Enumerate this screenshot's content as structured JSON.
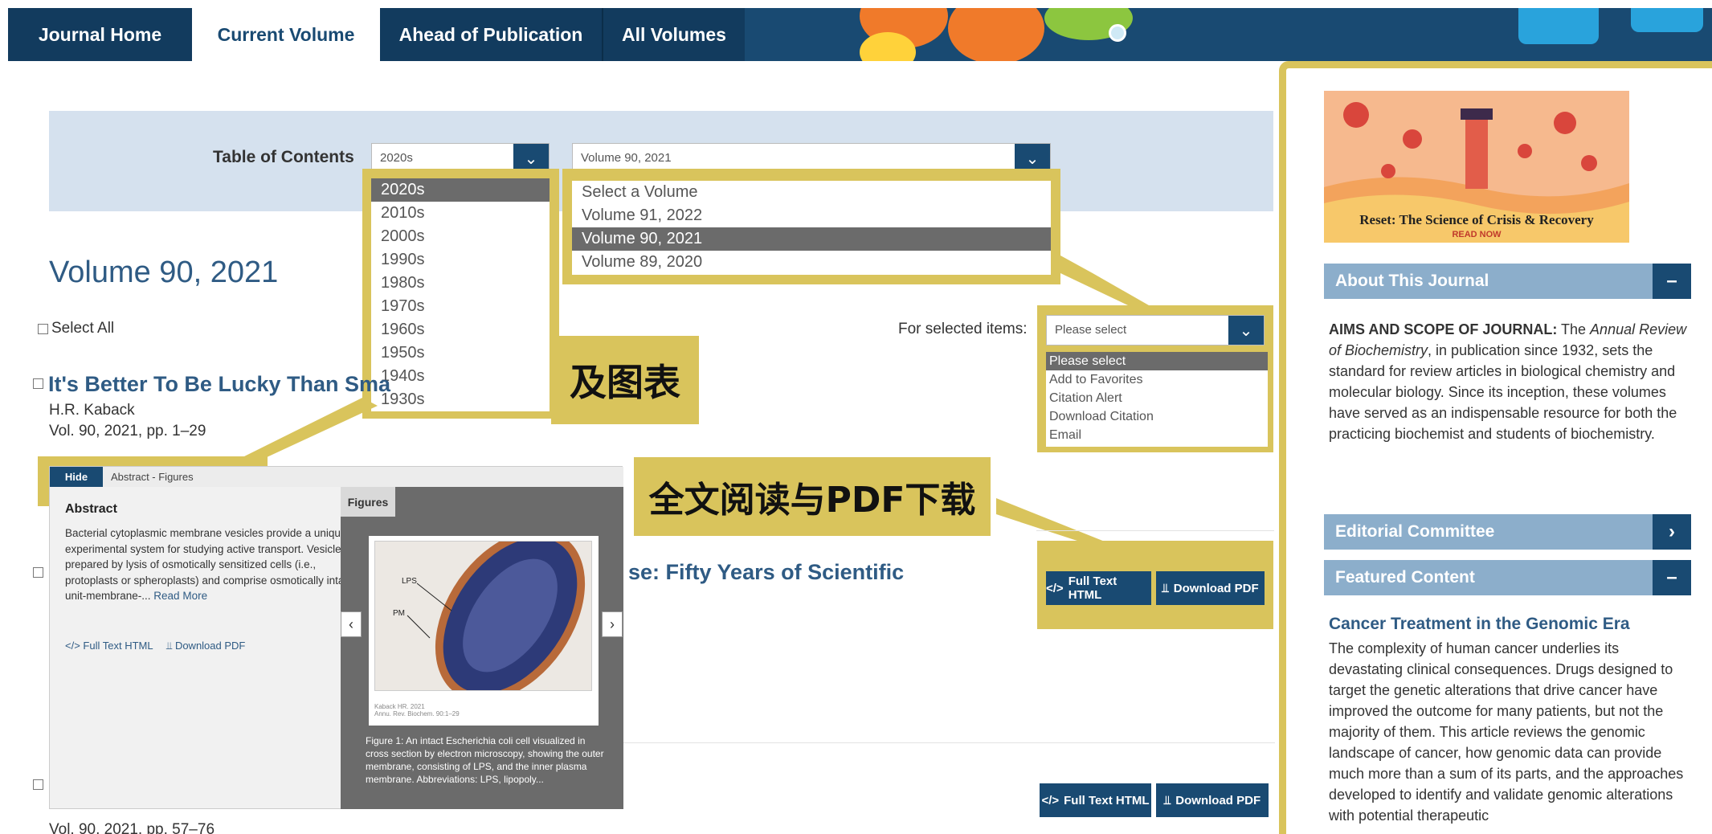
{
  "nav": {
    "tabs": [
      "Journal Home",
      "Current Volume",
      "Ahead of Publication",
      "All Volumes"
    ],
    "active": "Current Volume"
  },
  "toc": {
    "label": "Table of Contents",
    "decade_value": "2020s",
    "volume_value": "Volume 90, 2021",
    "decades": [
      "2020s",
      "2010s",
      "2000s",
      "1990s",
      "1980s",
      "1970s",
      "1960s",
      "1950s",
      "1940s",
      "1930s"
    ],
    "decade_selected": "2020s",
    "volumes": [
      "Select a Volume",
      "Volume 91, 2022",
      "Volume 90, 2021",
      "Volume 89, 2020"
    ],
    "volume_selected": "Volume 90, 2021"
  },
  "main": {
    "volume_heading": "Volume 90, 2021",
    "select_all": "Select All",
    "for_selected_label": "For selected items:",
    "for_selected_value": "Please select",
    "for_selected_options": [
      "Please select",
      "Add to Favorites",
      "Citation Alert",
      "Download Citation",
      "Email"
    ],
    "articles": [
      {
        "title": "It's Better To Be Lucky Than Sma",
        "author": "H.R. Kaback",
        "meta": "Vol. 90, 2021, pp. 1–29"
      },
      {
        "title": "se: Fifty Years of Scientific",
        "full_text": "Full Text HTML",
        "pdf": "Download PDF"
      },
      {
        "meta": "Vol. 90, 2021, pp. 57–76",
        "full_text": "Full Text HTML",
        "pdf": "Download PDF"
      }
    ]
  },
  "popup": {
    "hide": "Hide",
    "crumbs": "Abstract - Figures",
    "abstract_heading": "Abstract",
    "abstract_text": "Bacterial cytoplasmic membrane vesicles provide a unique experimental system for studying active transport. Vesicles are prepared by lysis of osmotically sensitized cells (i.e., protoplasts or spheroplasts) and comprise osmotically intact, unit-membrane-... ",
    "read_more": "Read More",
    "full_text": "Full Text HTML",
    "pdf": "Download PDF",
    "figures_tab": "Figures",
    "fig_labels": [
      "LPS",
      "PM"
    ],
    "fig_credit_1": "Kaback HR. 2021",
    "fig_credit_2": "Annu. Rev. Biochem. 90:1–29",
    "fig_caption": "Figure 1: An intact Escherichia coli cell visualized in cross section by electron microscopy, showing the outer membrane, consisting of LPS, and the inner plasma membrane. Abbreviations: LPS, lipopoly..."
  },
  "annotations": {
    "figures_note": "及图表",
    "fulltext_note": "全文阅读与PDF下载"
  },
  "sidebar": {
    "banner_title": "Reset: The Science of Crisis & Recovery",
    "banner_sub": "READ NOW",
    "about_title": "About This Journal",
    "about_lead": "AIMS AND SCOPE OF JOURNAL:",
    "about_pre": " The ",
    "about_journal": "Annual Review of Biochemistry",
    "about_rest": ", in publication since 1932, sets the standard for review articles in biological chemistry and molecular biology. Since its inception, these volumes have served as an indispensable resource for both the practicing biochemist and students of biochemistry.",
    "editorial_title": "Editorial Committee",
    "featured_title": "Featured Content",
    "featured_article": "Cancer Treatment in the Genomic Era",
    "featured_text": "The complexity of human cancer underlies its devastating clinical consequences. Drugs designed to target the genetic alterations that drive cancer have improved the outcome for many patients, but not the majority of them. This article reviews the genomic landscape of cancer, how genomic data can provide much more than a sum of its parts, and the approaches developed to identify and validate genomic alterations with potential therapeutic"
  }
}
